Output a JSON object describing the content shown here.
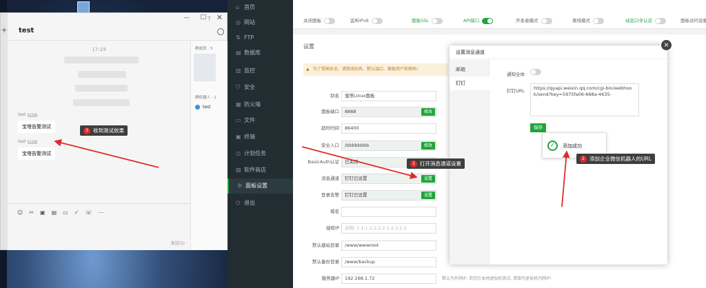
{
  "colors": {
    "accent": "#20a53a",
    "annotation_red": "#e02b2b",
    "sidebar_bg": "#222d32"
  },
  "wechat": {
    "plus": "+",
    "title": "test",
    "window_controls": {
      "min": "—",
      "max": "□",
      "close": "✕"
    },
    "time": "17:19",
    "messages": [
      {
        "sender": "test",
        "tag": "BOT",
        "text": "宝塔告警测试"
      },
      {
        "sender": "test",
        "tag": "BOT",
        "text": "宝塔告警测试"
      }
    ],
    "toolbar_icons": [
      "☺",
      "✂",
      "▣",
      "▤",
      "▭",
      "✓",
      "☏",
      "⋯"
    ],
    "send_label": "发送(S)",
    "members_label": "群成员 · 3",
    "robots_label": "群机器人 · 1",
    "robot_name": "test"
  },
  "sidebar": {
    "items": [
      {
        "icon": "⌂",
        "label": "首页"
      },
      {
        "icon": "◎",
        "label": "网站"
      },
      {
        "icon": "⇅",
        "label": "FTP"
      },
      {
        "icon": "▤",
        "label": "数据库"
      },
      {
        "icon": "▥",
        "label": "监控"
      },
      {
        "icon": "⛉",
        "label": "安全"
      },
      {
        "icon": "▦",
        "label": "防火墙"
      },
      {
        "icon": "▭",
        "label": "文件"
      },
      {
        "icon": "▣",
        "label": "终端"
      },
      {
        "icon": "◷",
        "label": "计划任务"
      },
      {
        "icon": "▧",
        "label": "软件商店"
      },
      {
        "icon": "⚙",
        "label": "面板设置"
      },
      {
        "icon": "⏻",
        "label": "退出"
      }
    ],
    "active_index": 11
  },
  "toggles": [
    {
      "label": "关闭面板",
      "on": false
    },
    {
      "label": "监听IPv6",
      "on": false
    },
    {
      "label": "面板SSL",
      "on": false
    },
    {
      "label": "API接口",
      "on": true
    },
    {
      "label": "开发者模式",
      "on": false
    },
    {
      "label": "离线模式",
      "on": false
    },
    {
      "label": "动态口令认证",
      "on": false
    },
    {
      "label": "面板访问设备",
      "on": false
    }
  ],
  "settings": {
    "title": "设置",
    "notice": "为了提高安全，请修改别名、默认端口、面板用户和密码!",
    "rows": [
      {
        "label": "别名",
        "value": "宝塔Linux面板",
        "button": "",
        "style": ""
      },
      {
        "label": "面板端口",
        "value": "8888",
        "button": "修改",
        "style": "dis"
      },
      {
        "label": "超时时间",
        "value": "86400",
        "button": "",
        "style": ""
      },
      {
        "label": "安全入口",
        "value": "/bbbbbbbb",
        "button": "修改",
        "style": "dis"
      },
      {
        "label": "BasicAuth认证",
        "value": "已关闭",
        "button": "",
        "style": "dis"
      },
      {
        "label": "消息通道",
        "value": "钉钉已设置",
        "button": "设置",
        "style": "dis"
      },
      {
        "label": "登录告警",
        "value": "钉钉已设置",
        "button": "设置",
        "style": "dis"
      },
      {
        "label": "域名",
        "value": "",
        "button": "",
        "style": ""
      },
      {
        "label": "授权IP",
        "value": "示例: 1.1.1.1,2.2.2.1-2.2.2.2",
        "button": "",
        "style": "ph"
      },
      {
        "label": "默认建站目录",
        "value": "/www/wwwroot",
        "button": "",
        "style": ""
      },
      {
        "label": "默认备份目录",
        "value": "/www/backup",
        "button": "",
        "style": ""
      },
      {
        "label": "服务器IP",
        "value": "192.168.1.72",
        "button": "",
        "style": ""
      }
    ],
    "tips": {
      "server_ip": "默认为外网IP, 若您在本地虚拟机测试, 请填写虚拟机内网IP!"
    }
  },
  "modal": {
    "title": "设置消息通道",
    "close": "×",
    "tabs": [
      "邮箱",
      "钉钉"
    ],
    "active_tab": 1,
    "notify_all_label": "通知全体",
    "url_label": "钉钉URL",
    "url_value": "https://qyapi.weixin.qq.com/cgi-bin/webhook/send?key=5975fa06-668a-4635-",
    "save_label": "保存",
    "toast_icon": "✓",
    "toast": "添加成功"
  },
  "annotations": [
    {
      "num": "1",
      "text": "打开消息通道设置"
    },
    {
      "num": "2",
      "text": "添加企业微信机器人的URL"
    },
    {
      "num": "3",
      "text": "收到测试效果"
    }
  ]
}
